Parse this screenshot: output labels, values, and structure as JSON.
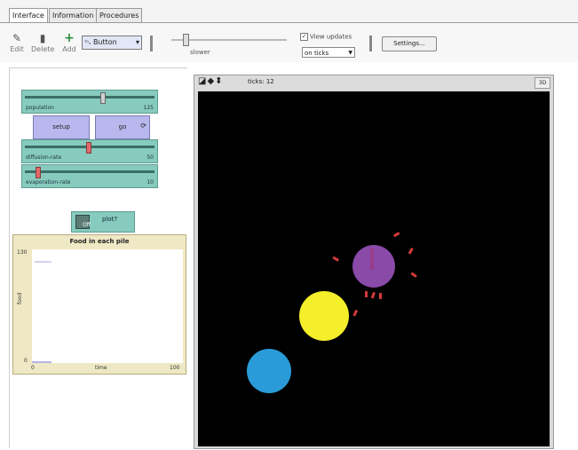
{
  "tabs": [
    "Interface",
    "Information",
    "Procedures"
  ],
  "toolbar": {
    "edit_label": "Edit",
    "delete_label": "Delete",
    "add_label": "Add",
    "widget_type": "Button",
    "speed_label": "slower",
    "view_updates_label": "View updates",
    "update_mode": "on ticks",
    "settings_label": "Settings..."
  },
  "widgets": {
    "population": {
      "name": "population",
      "value": "125"
    },
    "setup_label": "setup",
    "go_label": "go",
    "diffusion": {
      "name": "diffusion-rate",
      "value": "50"
    },
    "evaporation": {
      "name": "evaporation-rate",
      "value": "10"
    },
    "plot_switch": {
      "state": "Off",
      "label": "plot?"
    }
  },
  "plot": {
    "title": "Food in each pile",
    "ylabel": "food",
    "xlabel": "time",
    "xmin": "0",
    "xmax": "100",
    "ymin": "0",
    "ymax": "130"
  },
  "view": {
    "ticks": "ticks: 12",
    "threed_label": "3D"
  },
  "colors": {
    "slider": "#86cbbd",
    "button": "#b8b8ee",
    "plot_bg": "#efe8c4",
    "world_bg": "#000000",
    "pile_blue": "#2a9bd8",
    "pile_yellow": "#f4ef2a",
    "pile_purple": "#8a4aa8",
    "ant_color": "#d23a3a"
  }
}
